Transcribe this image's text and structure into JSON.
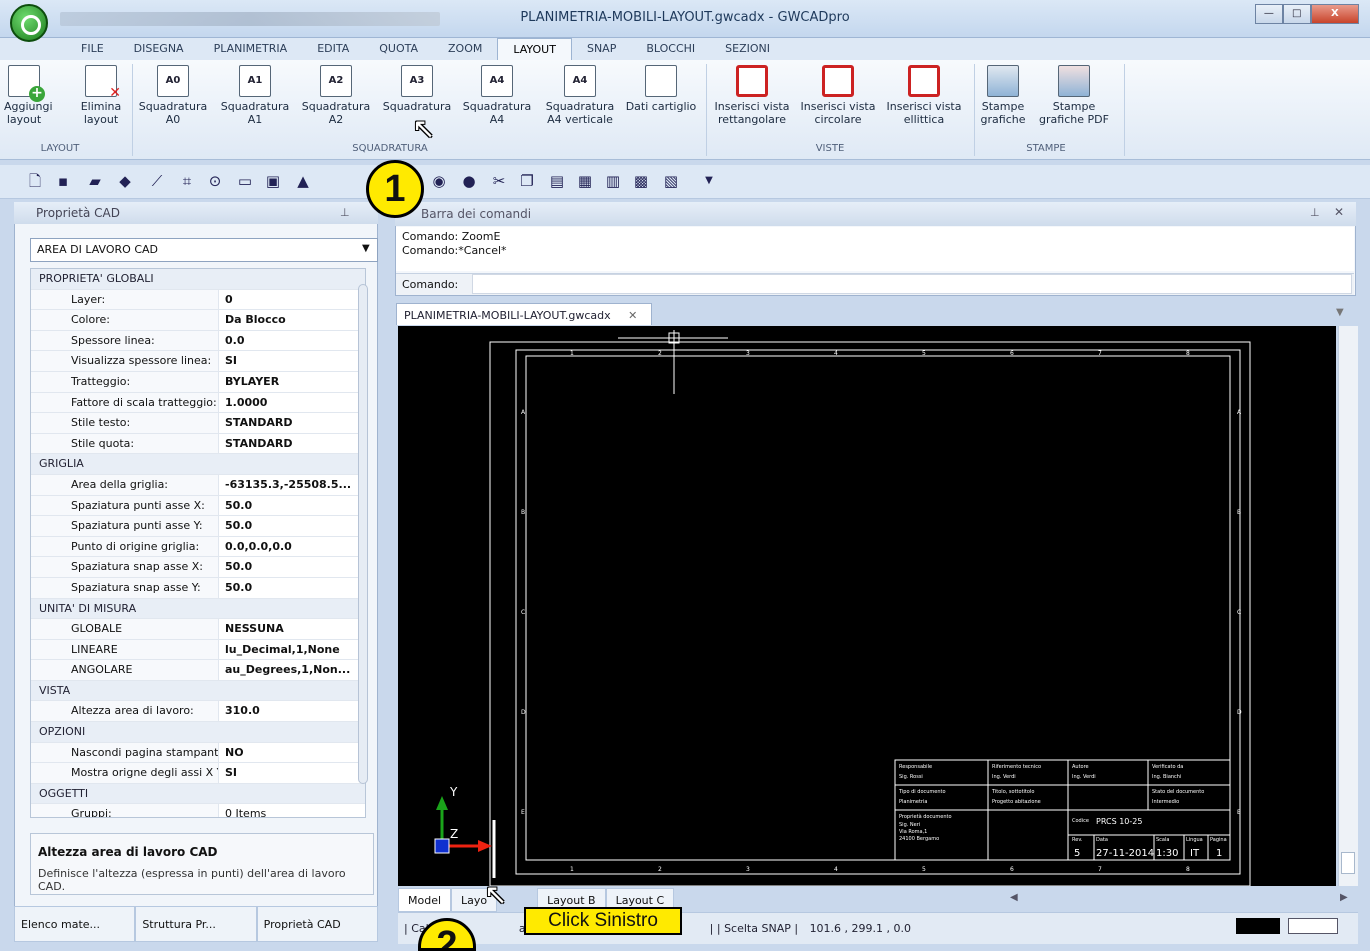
{
  "window": {
    "title": "PLANIMETRIA-MOBILI-LAYOUT.gwcadx - GWCADpro",
    "minimize": "—",
    "maximize": "□",
    "close": "X"
  },
  "tabs": [
    "FILE",
    "DISEGNA",
    "PLANIMETRIA",
    "EDITA",
    "QUOTA",
    "ZOOM",
    "LAYOUT",
    "SNAP",
    "BLOCCHI",
    "SEZIONI"
  ],
  "ribbon": {
    "layout_group": {
      "label": "LAYOUT",
      "buttons": [
        "Aggiungi layout",
        "Elimina layout"
      ]
    },
    "squadratura_group": {
      "label": "SQUADRATURA",
      "buttons": [
        {
          "icon": "A0",
          "label": "Squadratura A0"
        },
        {
          "icon": "A1",
          "label": "Squadratura A1"
        },
        {
          "icon": "A2",
          "label": "Squadratura A2"
        },
        {
          "icon": "A3",
          "label": "Squadratura"
        },
        {
          "icon": "A4",
          "label": "Squadratura A4"
        },
        {
          "icon": "A4",
          "label": "Squadratura A4 verticale"
        },
        {
          "icon": "",
          "label": "Dati cartiglio"
        }
      ]
    },
    "viste_group": {
      "label": "VISTE",
      "buttons": [
        "Inserisci vista rettangolare",
        "Inserisci vista circolare",
        "Inserisci vista ellittica"
      ]
    },
    "stampe_group": {
      "label": "STAMPE",
      "buttons": [
        "Stampe grafiche",
        "Stampe grafiche PDF"
      ]
    }
  },
  "left_panel": {
    "title": "Proprietà CAD",
    "selector": "AREA DI LAVORO CAD",
    "categories": [
      {
        "name": "PROPRIETA' GLOBALI",
        "rows": [
          [
            "Layer:",
            "0"
          ],
          [
            "Colore:",
            "Da Blocco"
          ],
          [
            "Spessore linea:",
            "0.0"
          ],
          [
            "Visualizza spessore linea:",
            "SI"
          ],
          [
            "Tratteggio:",
            "BYLAYER"
          ],
          [
            "Fattore di scala tratteggio:",
            "1.0000"
          ],
          [
            "Stile testo:",
            "STANDARD"
          ],
          [
            "Stile quota:",
            "STANDARD"
          ]
        ]
      },
      {
        "name": "GRIGLIA",
        "rows": [
          [
            "Area della griglia:",
            "-63135.3,-25508.5..."
          ],
          [
            "Spaziatura punti asse X:",
            "50.0"
          ],
          [
            "Spaziatura punti asse Y:",
            "50.0"
          ],
          [
            "Punto di origine griglia:",
            "0.0,0.0,0.0"
          ],
          [
            "Spaziatura snap asse X:",
            "50.0"
          ],
          [
            "Spaziatura snap asse Y:",
            "50.0"
          ]
        ]
      },
      {
        "name": "UNITA' DI MISURA",
        "rows": [
          [
            "GLOBALE",
            "NESSUNA"
          ],
          [
            "LINEARE",
            "lu_Decimal,1,None"
          ],
          [
            "ANGOLARE",
            "au_Degrees,1,Non..."
          ]
        ]
      },
      {
        "name": "VISTA",
        "rows": [
          [
            "Altezza area di lavoro:",
            "310.0"
          ]
        ]
      },
      {
        "name": "OPZIONI",
        "rows": [
          [
            "Nascondi pagina stampante",
            "NO"
          ],
          [
            "Mostra origne degli assi X Y",
            "SI"
          ]
        ]
      },
      {
        "name": "OGGETTI",
        "rows": [
          [
            "Gruppi:",
            "0 Items"
          ]
        ]
      }
    ],
    "description_title": "Altezza area di lavoro CAD",
    "description_text": "Definisce l'altezza (espressa in punti) dell'area di lavoro CAD.",
    "bottom_tabs": [
      "Elenco mate...",
      "Struttura Pr...",
      "Proprietà CAD"
    ]
  },
  "command_panel": {
    "title": "Barra dei comandi",
    "log": [
      "Comando: ZoomE",
      "Comando:*Cancel*"
    ],
    "prompt_label": "Comando:"
  },
  "document": {
    "tab": "PLANIMETRIA-MOBILI-LAYOUT.gwcadx"
  },
  "title_block": {
    "r1": [
      "Responsabile",
      "Sig. Rossi",
      "Riferimento tecnico",
      "Ing. Verdi",
      "Autore",
      "Ing. Verdi",
      "Verificato da",
      "Ing. Bianchi"
    ],
    "r2": [
      "Tipo di documento",
      "Planimetria",
      "Titolo, sottotitolo",
      "Progetto abitazione",
      "Stato del documento",
      "Intermedio"
    ],
    "r3": [
      "Proprietà documento",
      "Sig. Neri",
      "Via Roma,1",
      "24100 Bergamo",
      "Codice",
      "PRCS 10-25"
    ],
    "r4": [
      "Rev.",
      "5",
      "Data",
      "27-11-2014",
      "Scala",
      "1:30",
      "Lingua",
      "IT",
      "Pagina",
      "1"
    ],
    "top_numbers": [
      "1",
      "2",
      "3",
      "4",
      "5",
      "6",
      "7",
      "8"
    ],
    "side_letters": [
      "A",
      "B",
      "C",
      "D",
      "E"
    ]
  },
  "layout_tabs": [
    "Model",
    "Layo",
    "Layout B",
    "Layout C"
  ],
  "status": {
    "left": "| Cala",
    "mid": "a 0",
    "snap": "| | Scelta SNAP |",
    "coords": "101.6 , 299.1 , 0.0"
  },
  "callouts": {
    "one": "1",
    "two": "2",
    "label": "Click Sinistro"
  },
  "colors": {
    "ribbon": "#dfe9f5",
    "canvas": "#000000",
    "callout": "#ffea00"
  }
}
